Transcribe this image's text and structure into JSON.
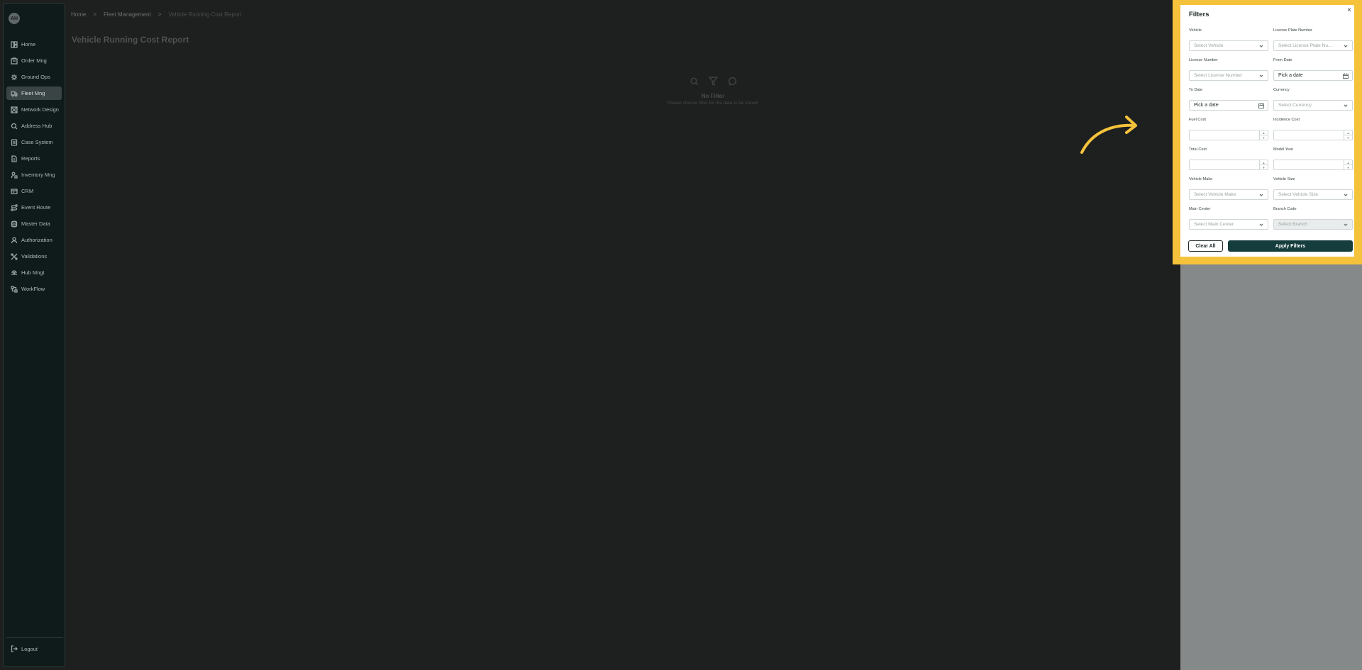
{
  "sidebar": {
    "logo_text": "AH",
    "items": [
      {
        "label": "Home",
        "icon": "home-icon"
      },
      {
        "label": "Order Mng",
        "icon": "order-icon"
      },
      {
        "label": "Ground Ops",
        "icon": "ground-ops-icon"
      },
      {
        "label": "Fleet Mng",
        "icon": "truck-icon",
        "active": true
      },
      {
        "label": "Network Design",
        "icon": "network-icon"
      },
      {
        "label": "Address Hub",
        "icon": "address-icon"
      },
      {
        "label": "Case System",
        "icon": "case-icon"
      },
      {
        "label": "Reports",
        "icon": "reports-icon"
      },
      {
        "label": "Inventory Mng",
        "icon": "inventory-icon"
      },
      {
        "label": "CRM",
        "icon": "crm-icon"
      },
      {
        "label": "Event Route",
        "icon": "route-icon"
      },
      {
        "label": "Master Data",
        "icon": "database-icon"
      },
      {
        "label": "Authorization",
        "icon": "user-icon"
      },
      {
        "label": "Validations",
        "icon": "validations-icon"
      },
      {
        "label": "Hub Mngt",
        "icon": "hub-icon"
      },
      {
        "label": "WorkFlow",
        "icon": "workflow-icon"
      }
    ],
    "logout_label": "Logout"
  },
  "breadcrumb": {
    "home": "Home",
    "section": "Fleet Management",
    "current": "Vehicle Running Cost Report"
  },
  "page": {
    "title": "Vehicle Running Cost Report",
    "empty_title": "No Filter",
    "empty_subtitle": "Please choose filter for the data to be shown"
  },
  "filters": {
    "title": "Filters",
    "close_label": "×",
    "fields": {
      "vehicle": {
        "label": "Vehicle",
        "placeholder": "Select Vehicle"
      },
      "license_plate": {
        "label": "License Plate Number",
        "placeholder": "Select License Plate Nu..."
      },
      "license_number": {
        "label": "License Number",
        "placeholder": "Select License Number"
      },
      "from_date": {
        "label": "From Date",
        "placeholder": "Pick a date"
      },
      "to_date": {
        "label": "To Date",
        "placeholder": "Pick a date"
      },
      "currency": {
        "label": "Currency",
        "placeholder": "Select Currency"
      },
      "fuel_cost": {
        "label": "Fuel Cost",
        "placeholder": ""
      },
      "incidence_cost": {
        "label": "Incidence Cost",
        "placeholder": ""
      },
      "total_cost": {
        "label": "Total Cost",
        "placeholder": ""
      },
      "model_year": {
        "label": "Model Year",
        "placeholder": ""
      },
      "vehicle_make": {
        "label": "Vehicle Make",
        "placeholder": "Select Vehicle Make"
      },
      "vehicle_size": {
        "label": "Vehicle Size",
        "placeholder": "Select Vehicle Size"
      },
      "main_center": {
        "label": "Main Center",
        "placeholder": "Select Main Center"
      },
      "branch_code": {
        "label": "Branch Code",
        "placeholder": "Select Branch"
      }
    },
    "clear_label": "Clear All",
    "apply_label": "Apply Filters"
  },
  "colors": {
    "highlight": "#f5c33b",
    "apply_button": "#153d3d",
    "sidebar_bg": "#0f1a1a"
  }
}
